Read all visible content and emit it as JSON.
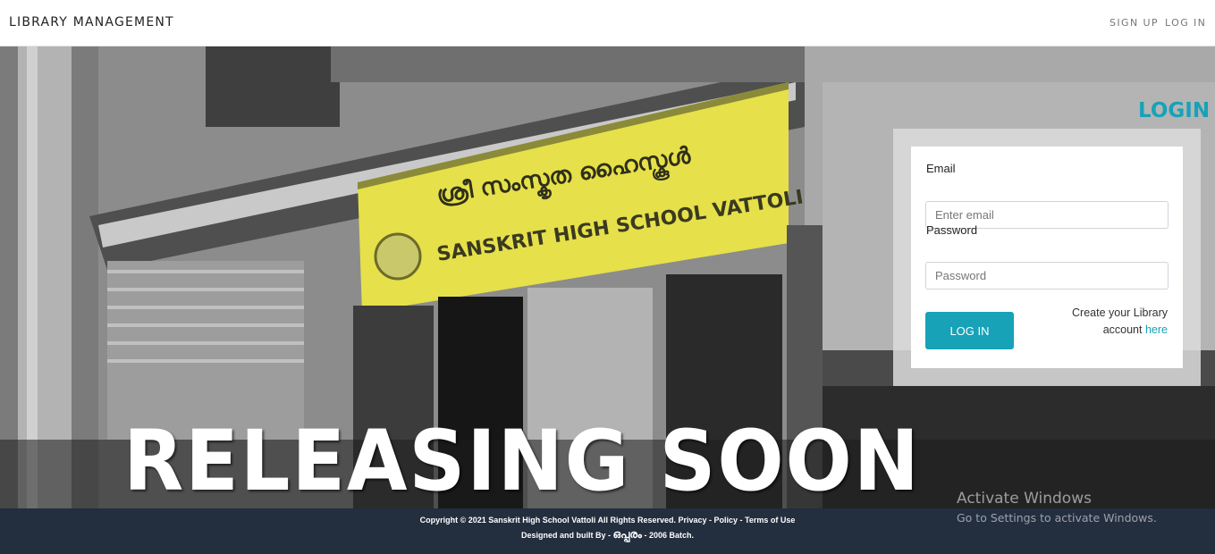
{
  "navbar": {
    "brand": "LIBRARY MANAGEMENT",
    "links": {
      "signup": "SIGN UP",
      "login": "LOG IN"
    }
  },
  "hero": {
    "banner_text": "RELEASING SOON",
    "sign_text": "SANSKRIT HIGH SCHOOL VATTOLI"
  },
  "login": {
    "heading": "LOGIN",
    "email_label": "Email",
    "email_placeholder": "Enter email",
    "password_label": "Password",
    "password_placeholder": "Password",
    "submit_label": "LOG IN",
    "create_text_1": "Create your Library",
    "create_text_2": "account",
    "create_link": "here"
  },
  "footer": {
    "line1": "Copyright © 2021 Sanskrit High School Vattoli All Rights Reserved. Privacy - Policy - Terms of Use",
    "line2_prefix": "Designed and built By - ",
    "line2_name": "ഒപ്പരം",
    "line2_suffix": " - 2006 Batch."
  },
  "watermark": {
    "title": "Activate Windows",
    "subtitle": "Go to Settings to activate Windows."
  },
  "colors": {
    "accent": "#17a2b8",
    "footer_bg": "#232e3f",
    "sign_yellow": "#e6e04a"
  }
}
